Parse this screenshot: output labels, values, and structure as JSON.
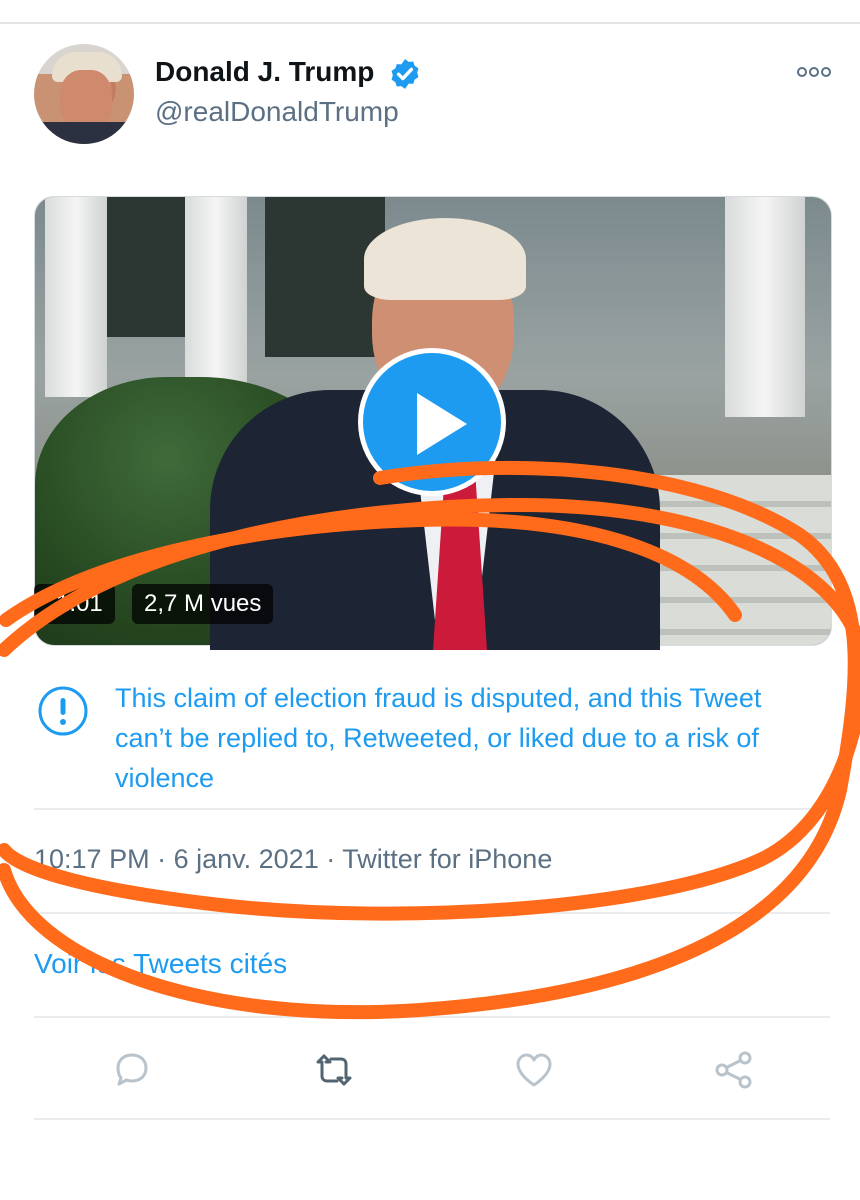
{
  "tweet": {
    "author": {
      "name": "Donald J. Trump",
      "handle": "@realDonaldTrump",
      "verified": true
    },
    "media": {
      "duration": "1:01",
      "views": "2,7 M vues",
      "play_icon": "play-icon"
    },
    "notice": {
      "icon": "warning-exclamation-icon",
      "text": "This claim of election fraud is disputed, and this Tweet can’t be replied to, Retweeted, or liked due to a risk of violence"
    },
    "meta": {
      "time": "10:17 PM",
      "date": "6 janv. 2021",
      "source": "Twitter for iPhone"
    },
    "quote_link": "Voir les Tweets cités",
    "actions": [
      "reply-icon",
      "retweet-icon",
      "like-icon",
      "share-icon"
    ]
  },
  "colors": {
    "accent": "#1d9bf0",
    "secondary_text": "#5b7083",
    "annotation": "#ff6b1a"
  }
}
